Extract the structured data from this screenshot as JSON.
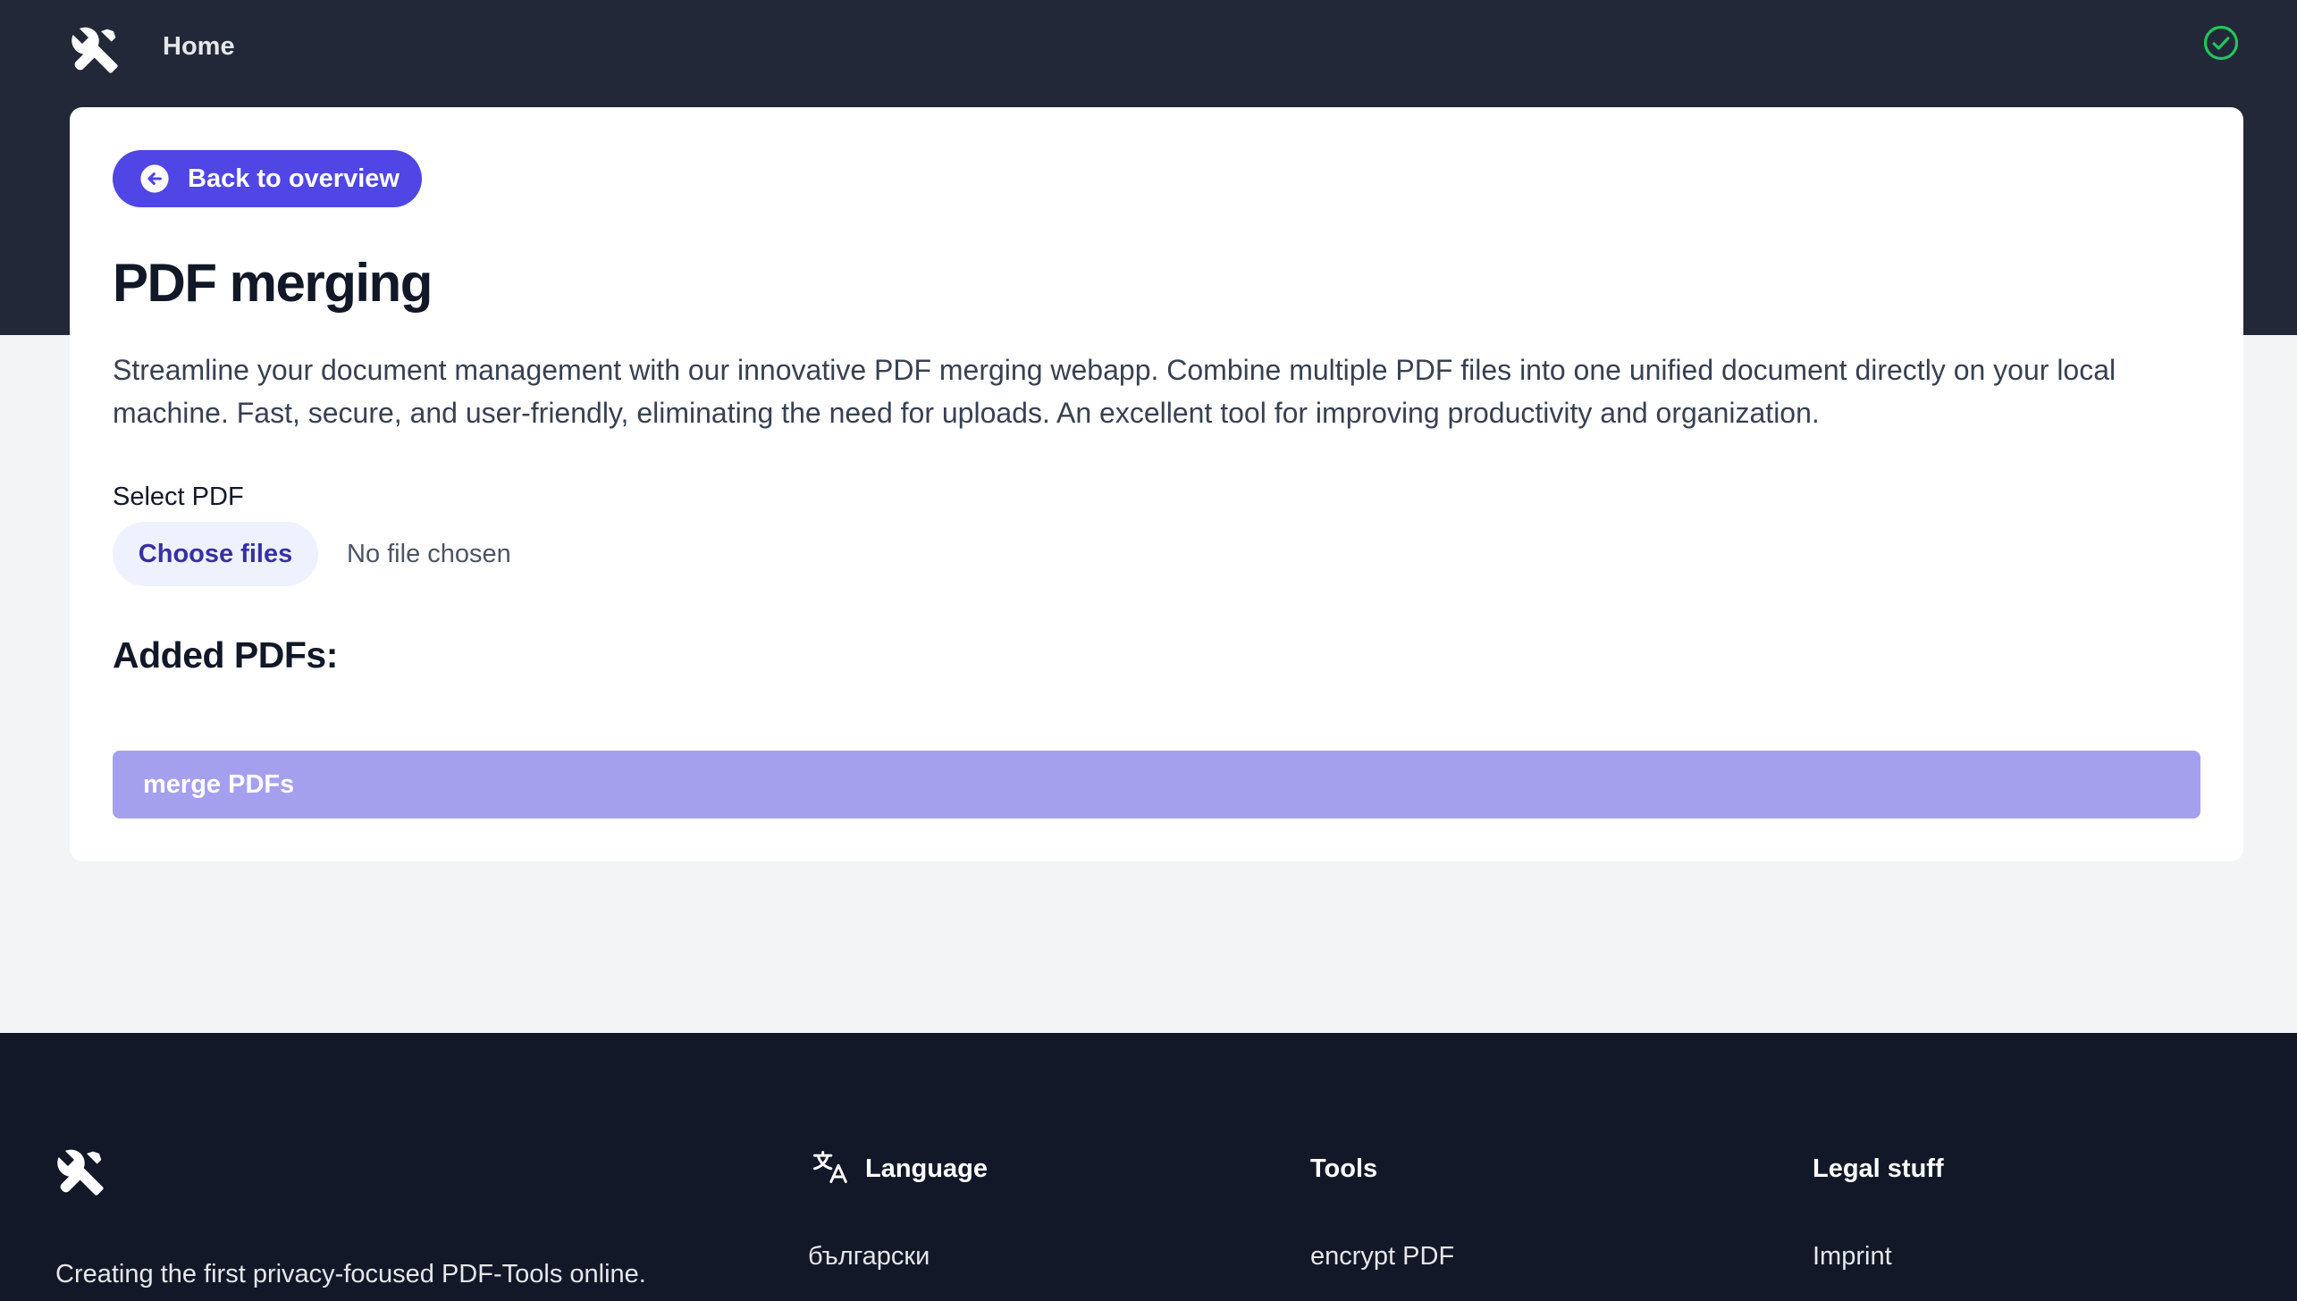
{
  "nav": {
    "home_label": "Home",
    "logo_icon": "tools-icon",
    "status_icon": "check-circle-icon",
    "status_color": "#22c55e"
  },
  "card": {
    "back_label": "Back to overview",
    "title": "PDF merging",
    "description": "Streamline your document management with our innovative PDF merging webapp. Combine multiple PDF files into one unified document directly on your local machine. Fast, secure, and user-friendly, eliminating the need for uploads. An excellent tool for improving productivity and organization.",
    "select_label": "Select PDF",
    "choose_files_label": "Choose files",
    "no_file_text": "No file chosen",
    "added_title": "Added PDFs:",
    "merge_label": "merge PDFs"
  },
  "footer": {
    "tagline": "Creating the first privacy-focused PDF-Tools online.",
    "language_title": "Language",
    "language_link": "български",
    "tools_title": "Tools",
    "tools_link": "encrypt PDF",
    "legal_title": "Legal stuff",
    "legal_link": "Imprint"
  },
  "colors": {
    "header_bg": "#222837",
    "footer_bg": "#121827",
    "accent": "#4f46e5",
    "accent_light": "#eef2ff",
    "merge_disabled": "#a5a0ee",
    "page_bg": "#f3f4f6"
  }
}
